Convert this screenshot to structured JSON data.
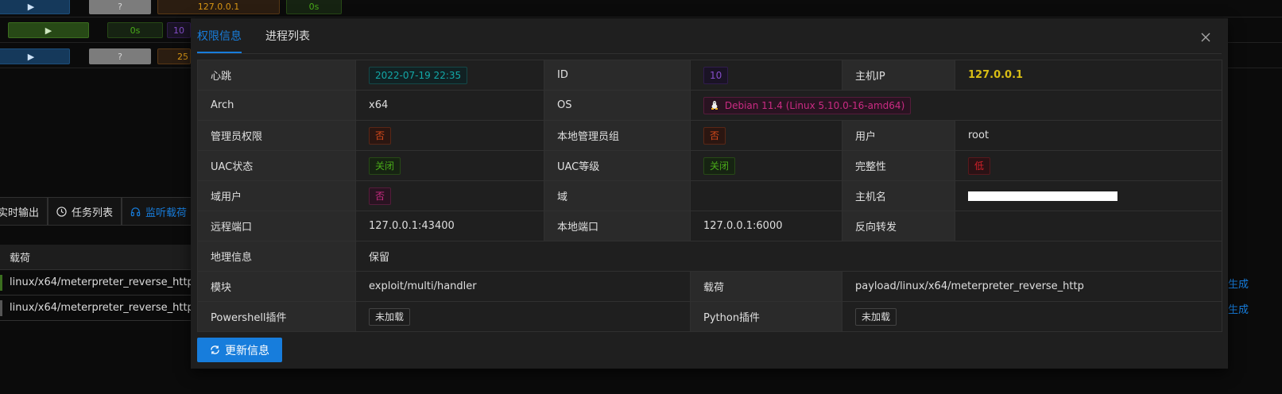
{
  "background": {
    "rows": [
      {
        "q": "?",
        "ip": "127.0.0.1",
        "time": "0s"
      },
      {
        "time": "0s",
        "id": "10"
      },
      {
        "q": "?",
        "value": "25"
      }
    ],
    "tabs": [
      {
        "label": "实时输出",
        "icon": "terminal-icon"
      },
      {
        "label": "任务列表",
        "icon": "clock-icon"
      },
      {
        "label": "监听载荷",
        "icon": "headphones-icon"
      }
    ],
    "table": {
      "header": "载荷",
      "rows": [
        "linux/x64/meterpreter_reverse_http",
        "linux/x64/meterpreter_reverse_http"
      ],
      "right_link": "生成"
    }
  },
  "modal": {
    "tabs": [
      {
        "label": "权限信息",
        "active": true
      },
      {
        "label": "进程列表",
        "active": false
      }
    ],
    "info": {
      "heartbeat_label": "心跳",
      "heartbeat_value": "2022-07-19 22:35",
      "id_label": "ID",
      "id_value": "10",
      "host_ip_label": "主机IP",
      "host_ip_value": "127.0.0.1",
      "arch_label": "Arch",
      "arch_value": "x64",
      "os_label": "OS",
      "os_value": "Debian 11.4 (Linux 5.10.0-16-amd64)",
      "admin_label": "管理员权限",
      "admin_value": "否",
      "local_admin_label": "本地管理员组",
      "local_admin_value": "否",
      "user_label": "用户",
      "user_value": "root",
      "uac_status_label": "UAC状态",
      "uac_status_value": "关闭",
      "uac_level_label": "UAC等级",
      "uac_level_value": "关闭",
      "integrity_label": "完整性",
      "integrity_value": "低",
      "domain_user_label": "域用户",
      "domain_user_value": "否",
      "domain_label": "域",
      "domain_value": "",
      "hostname_label": "主机名",
      "remote_port_label": "远程端口",
      "remote_port_value": "127.0.0.1:43400",
      "local_port_label": "本地端口",
      "local_port_value": "127.0.0.1:6000",
      "reverse_forward_label": "反向转发",
      "reverse_forward_value": "",
      "geo_label": "地理信息",
      "geo_value": "保留",
      "module_label": "模块",
      "module_value": "exploit/multi/handler",
      "payload_label": "载荷",
      "payload_value": "payload/linux/x64/meterpreter_reverse_http",
      "powershell_label": "Powershell插件",
      "powershell_value": "未加载",
      "python_label": "Python插件",
      "python_value": "未加载"
    },
    "refresh_button": "更新信息"
  },
  "colors": {
    "accent": "#177ddc",
    "gold": "#d8bd14"
  }
}
